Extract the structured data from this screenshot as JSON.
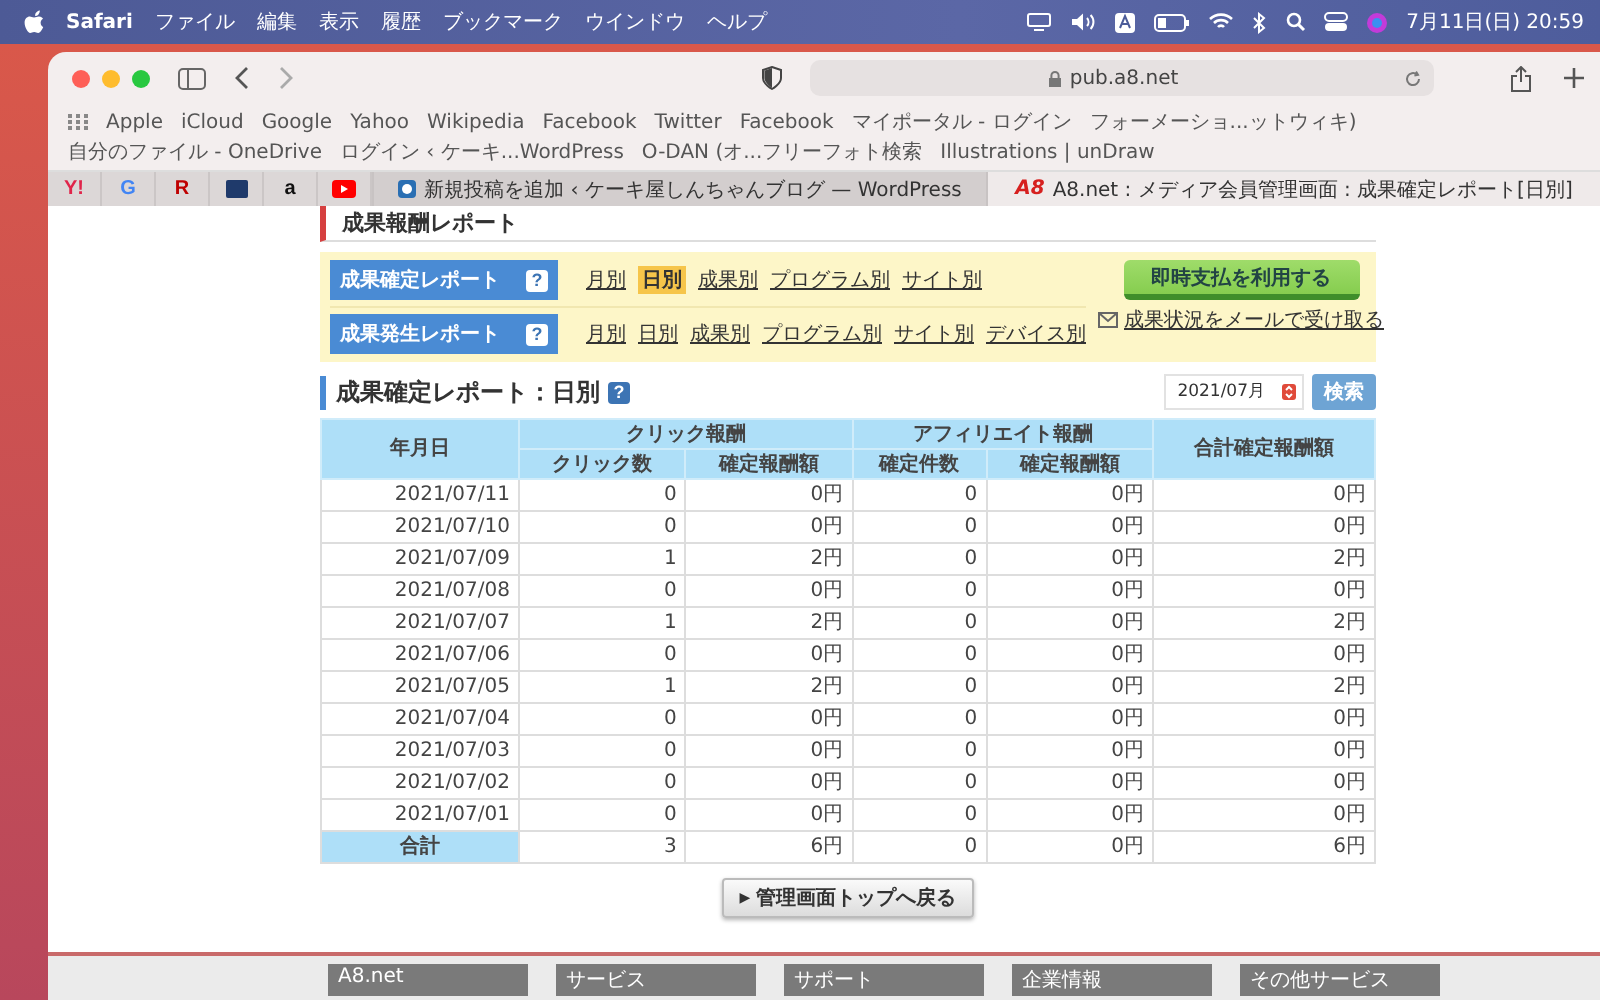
{
  "menu_bar": {
    "app": "Safari",
    "items": [
      "ファイル",
      "編集",
      "表示",
      "履歴",
      "ブックマーク",
      "ウインドウ",
      "ヘルプ"
    ],
    "clock": "7月11日(日)  20:59"
  },
  "toolbar": {
    "url": "pub.a8.net"
  },
  "bookmarks": [
    "Apple",
    "iCloud",
    "Google",
    "Yahoo",
    "Wikipedia",
    "Facebook",
    "Twitter",
    "Facebook",
    "マイポータル - ログイン",
    "フォーメーショ...ットウィキ)",
    "自分のファイル - OneDrive",
    "ログイン ‹ ケーキ...WordPress",
    "O-DAN (オ...フリーフォト検索",
    "Illustrations | unDraw"
  ],
  "pinned_tabs": [
    {
      "kind": "letter",
      "text": "Y!",
      "color": "#e0244a"
    },
    {
      "kind": "letter",
      "text": "G",
      "color": "#4285f4"
    },
    {
      "kind": "letter",
      "text": "R",
      "color": "#bf0000"
    },
    {
      "kind": "box",
      "color": "#1f3a6b"
    },
    {
      "kind": "letter",
      "text": "a",
      "color": "#111111"
    },
    {
      "kind": "play",
      "color": "#ff0000"
    }
  ],
  "tabs": [
    {
      "title": "新規投稿を追加 ‹ ケーキ屋しんちゃんブログ — WordPress",
      "selected": false,
      "kind": "square"
    },
    {
      "title": "A8.net : メディア会員管理画面 : 成果確定レポート[日別]",
      "selected": true,
      "kind": "logo",
      "logo_text": "A8"
    }
  ],
  "section_title": "成果報酬レポート",
  "report_nav": {
    "rows": [
      {
        "label": "成果確定レポート",
        "help": "?",
        "links": [
          {
            "text": "月別",
            "selected": false
          },
          {
            "text": "日別",
            "selected": true
          },
          {
            "text": "成果別",
            "selected": false
          },
          {
            "text": "プログラム別",
            "selected": false
          },
          {
            "text": "サイト別",
            "selected": false
          }
        ]
      },
      {
        "label": "成果発生レポート",
        "help": "?",
        "links": [
          {
            "text": "月別",
            "selected": false
          },
          {
            "text": "日別",
            "selected": false
          },
          {
            "text": "成果別",
            "selected": false
          },
          {
            "text": "プログラム別",
            "selected": false
          },
          {
            "text": "サイト別",
            "selected": false
          },
          {
            "text": "デバイス別",
            "selected": false
          }
        ]
      }
    ],
    "pay_button": "即時支払を利用する",
    "mail_link": "成果状況をメールで受け取る"
  },
  "report": {
    "title": "成果確定レポート：日別",
    "help": "?",
    "month": "2021/07月",
    "search_button": "検索"
  },
  "table": {
    "date_header": "年月日",
    "groups": [
      {
        "label": "クリック報酬",
        "columns": [
          "クリック数",
          "確定報酬額"
        ]
      },
      {
        "label": "アフィリエイト報酬",
        "columns": [
          "確定件数",
          "確定報酬額"
        ]
      }
    ],
    "total_header": "合計確定報酬額",
    "rows": [
      [
        "2021/07/11",
        "0",
        "0円",
        "0",
        "0円",
        "0円"
      ],
      [
        "2021/07/10",
        "0",
        "0円",
        "0",
        "0円",
        "0円"
      ],
      [
        "2021/07/09",
        "1",
        "2円",
        "0",
        "0円",
        "2円"
      ],
      [
        "2021/07/08",
        "0",
        "0円",
        "0",
        "0円",
        "0円"
      ],
      [
        "2021/07/07",
        "1",
        "2円",
        "0",
        "0円",
        "2円"
      ],
      [
        "2021/07/06",
        "0",
        "0円",
        "0",
        "0円",
        "0円"
      ],
      [
        "2021/07/05",
        "1",
        "2円",
        "0",
        "0円",
        "2円"
      ],
      [
        "2021/07/04",
        "0",
        "0円",
        "0",
        "0円",
        "0円"
      ],
      [
        "2021/07/03",
        "0",
        "0円",
        "0",
        "0円",
        "0円"
      ],
      [
        "2021/07/02",
        "0",
        "0円",
        "0",
        "0円",
        "0円"
      ],
      [
        "2021/07/01",
        "0",
        "0円",
        "0",
        "0円",
        "0円"
      ]
    ],
    "total_row": [
      "合計",
      "3",
      "6円",
      "0",
      "0円",
      "6円"
    ]
  },
  "back_button": {
    "icon": "▶",
    "label": "管理画面トップへ戻る"
  },
  "footer": [
    "A8.net",
    "サービス",
    "サポート",
    "企業情報",
    "その他サービス"
  ]
}
